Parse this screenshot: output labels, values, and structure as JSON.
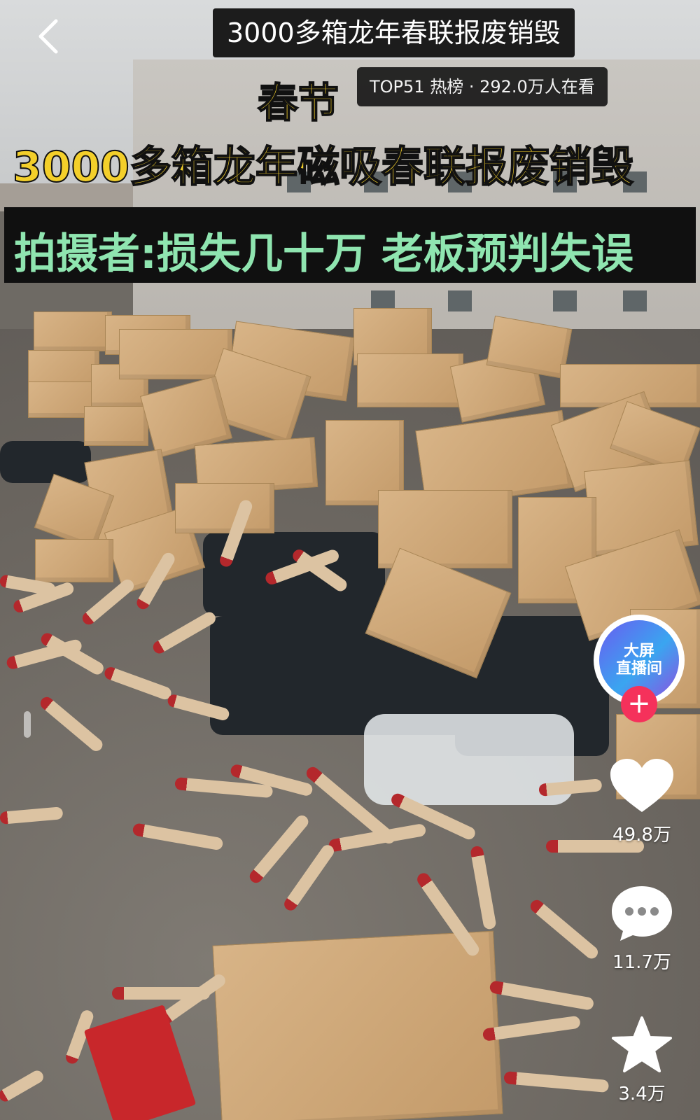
{
  "header": {
    "back_label": "",
    "title": "3000多箱龙年春联报废销毁",
    "hot_badge": "TOP51 热榜 · 292.0万人在看"
  },
  "caption": {
    "line1": "春节",
    "line2": "3000多箱龙年磁吸春联报废销毁",
    "line3": "拍摄者:损失几十万 老板预判失误"
  },
  "live": {
    "line1": "大屏",
    "line2": "直播间"
  },
  "follow_symbol": "+",
  "actions": {
    "likes": "49.8万",
    "comments": "11.7万",
    "favorites": "3.4万"
  },
  "colors": {
    "caption_yellow": "#f3cf2a",
    "caption_green": "#8fe5b0",
    "follow_red": "#f5315b"
  }
}
